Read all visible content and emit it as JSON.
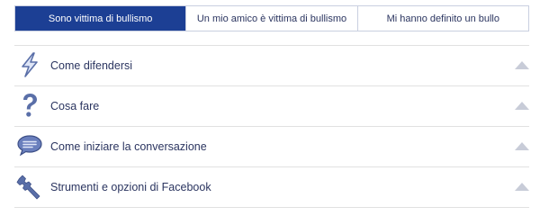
{
  "tabs": [
    {
      "label": "Sono vittima di bullismo",
      "active": true
    },
    {
      "label": "Un mio amico è vittima di bullismo",
      "active": false
    },
    {
      "label": "Mi hanno definito un bullo",
      "active": false
    }
  ],
  "sections": [
    {
      "label": "Come difendersi",
      "icon": "lightning-icon"
    },
    {
      "label": "Cosa fare",
      "icon": "question-mark-icon"
    },
    {
      "label": "Come iniziare la conversazione",
      "icon": "speech-bubble-icon"
    },
    {
      "label": "Strumenti e opzioni di Facebook",
      "icon": "wrench-icon"
    }
  ],
  "colors": {
    "active_tab": "#1c3f94",
    "text": "#2b3560",
    "icon": "#5a6fa8",
    "icon_dark": "#3d4f86",
    "arrow": "#c8ccd8",
    "divider": "#e1e1e1"
  }
}
